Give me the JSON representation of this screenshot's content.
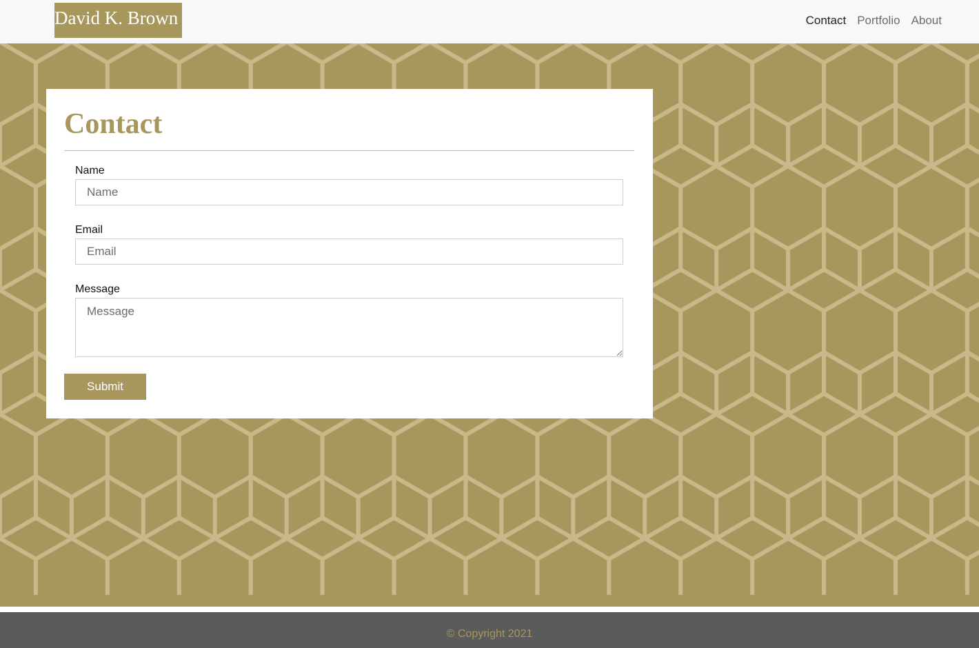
{
  "colors": {
    "accent": "#a8975c",
    "navbar_bg": "#f7f8f9",
    "footer_bg": "#5b5b5b",
    "hex_line": "#c7b98a"
  },
  "navbar": {
    "brand": "David K. Brown",
    "links": [
      {
        "label": "Contact",
        "active": true
      },
      {
        "label": "Portfolio",
        "active": false
      },
      {
        "label": "About",
        "active": false
      }
    ]
  },
  "contact": {
    "title": "Contact",
    "fields": {
      "name": {
        "label": "Name",
        "placeholder": "Name",
        "value": ""
      },
      "email": {
        "label": "Email",
        "placeholder": "Email",
        "value": ""
      },
      "message": {
        "label": "Message",
        "placeholder": "Message",
        "value": ""
      }
    },
    "submit_label": "Submit"
  },
  "footer": {
    "copyright": "© Copyright 2021"
  }
}
